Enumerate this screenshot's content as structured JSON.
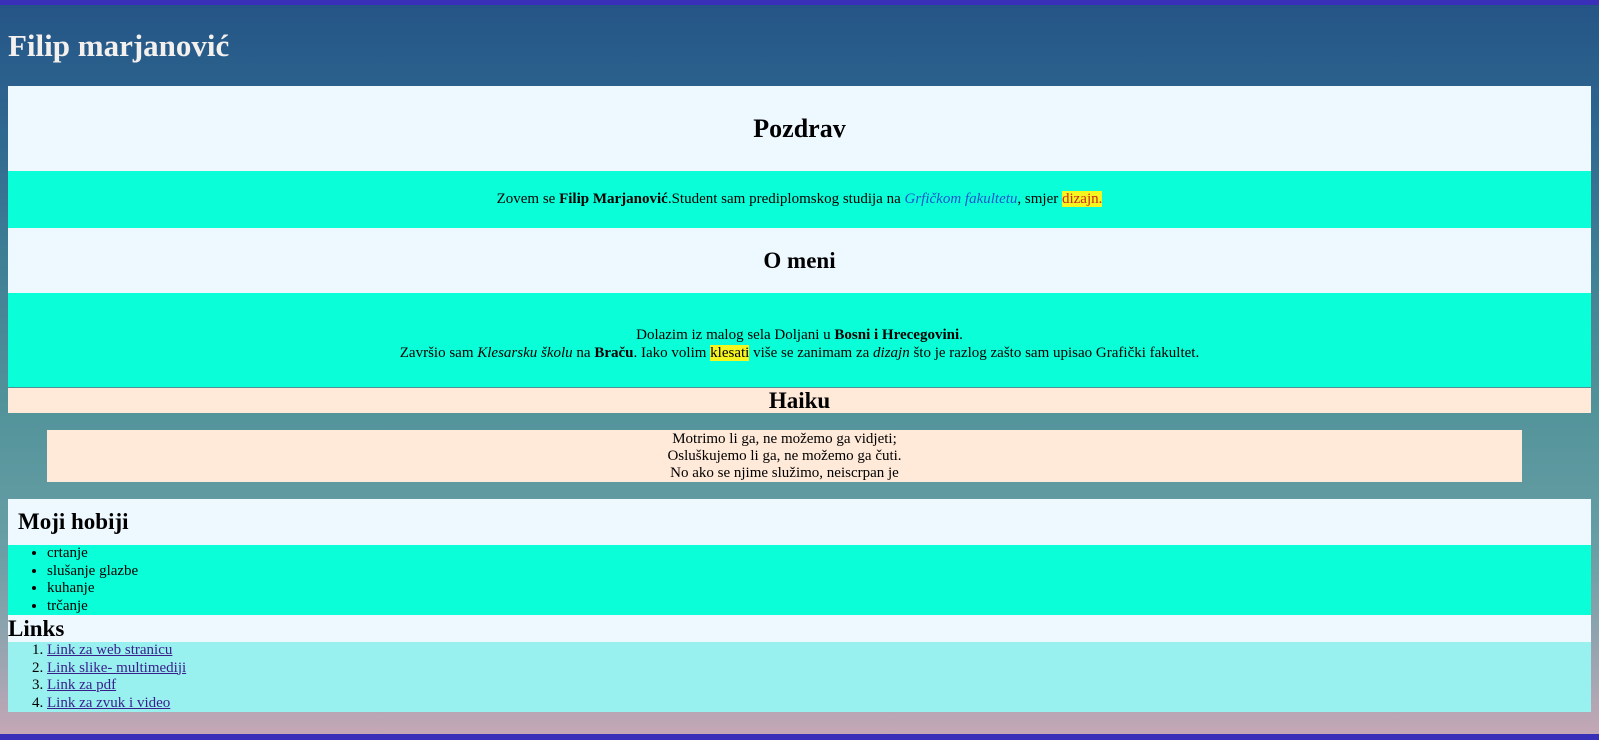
{
  "site_title": "Filip marjanović",
  "greeting": {
    "heading": "Pozdrav",
    "t1": "Zovem se ",
    "name": "Filip Marjanović",
    "t2": ".Student sam prediplomskog studija na ",
    "faculty": "Grfičkom fakultetu",
    "t3": ", smjer ",
    "major": "dizajn."
  },
  "about": {
    "heading": "O meni",
    "l1_a": "Dolazim iz malog sela Doljani u ",
    "l1_b": "Bosni i Hrecegovini",
    "l1_c": ".",
    "l2_a": "Završio sam ",
    "l2_b": "Klesarsku školu",
    "l2_c": " na ",
    "l2_d": "Braču",
    "l2_e": ". Iako volim ",
    "l2_f": "klesati",
    "l2_g": " više se zanimam za ",
    "l2_h": "dizajn",
    "l2_i": " što je razlog zašto sam upisao Grafički fakultet."
  },
  "haiku": {
    "heading": "Haiku",
    "lines": [
      "Motrimo li ga, ne možemo ga vidjeti;",
      "Osluškujemo li ga, ne možemo ga čuti.",
      "No ako se njime služimo, neiscrpan je"
    ]
  },
  "hobbies": {
    "heading": "Moji hobiji",
    "items": [
      "crtanje",
      "slušanje glazbe",
      "kuhanje",
      "trčanje"
    ]
  },
  "links": {
    "heading": "Links",
    "items": [
      "Link za web stranicu",
      "Link slike- multimediji",
      "Link za pdf",
      "Link za zvuk i video"
    ]
  }
}
